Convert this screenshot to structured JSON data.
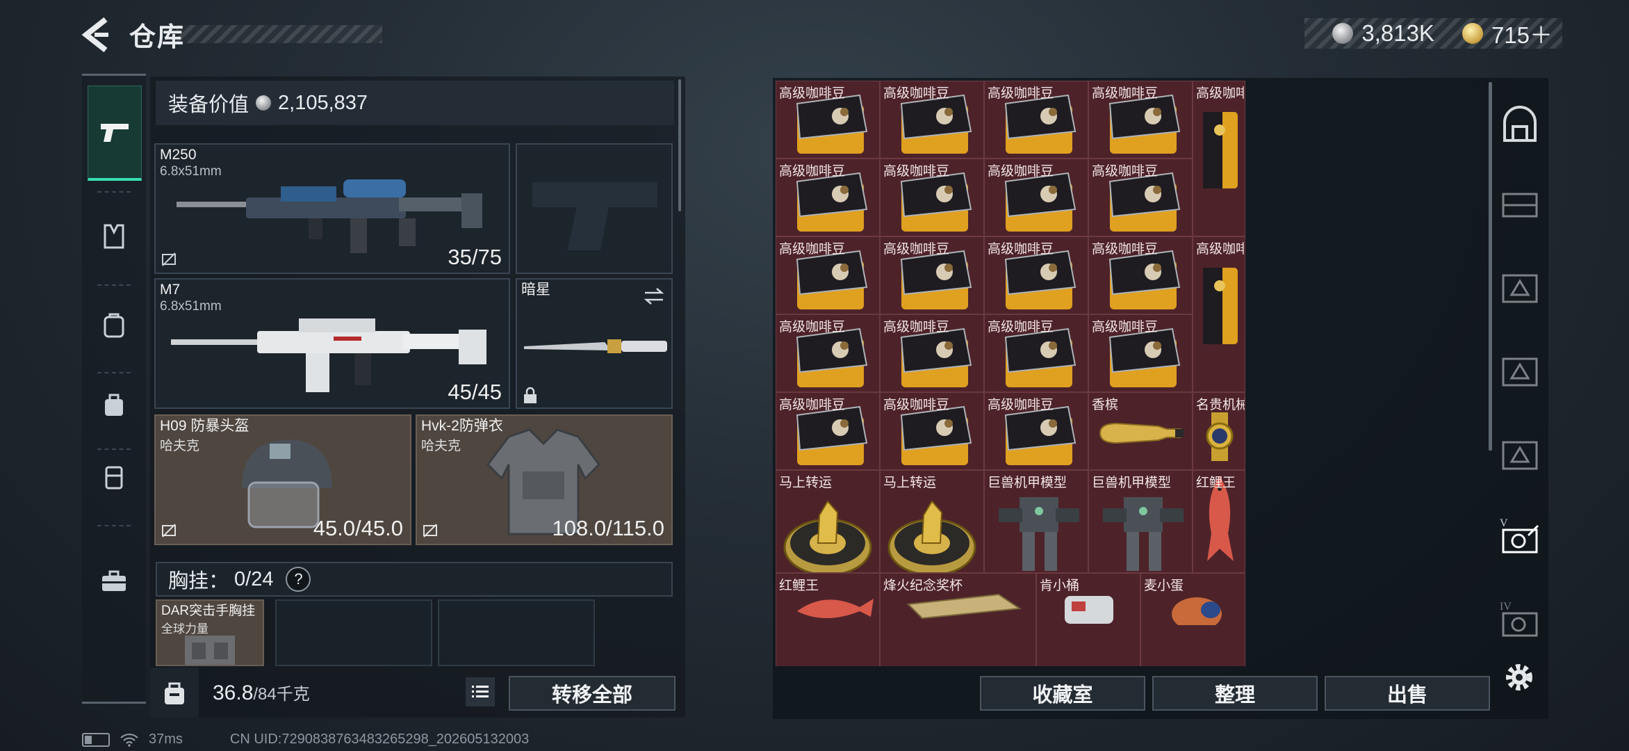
{
  "header": {
    "title": "仓库"
  },
  "currency": {
    "silver": "3,813K",
    "gold": "715＋"
  },
  "equipment": {
    "value_label": "装备价值",
    "value": "2,105,837",
    "primary": {
      "name": "M250",
      "caliber": "6.8x51mm",
      "ammo": "35/75"
    },
    "secondary": {
      "name": "M7",
      "caliber": "6.8x51mm",
      "ammo": "45/45"
    },
    "melee": {
      "name": "暗星"
    },
    "helmet": {
      "name": "H09 防暴头盔",
      "brand": "哈夫克",
      "durability": "45.0/45.0"
    },
    "armor": {
      "name": "Hvk-2防弹衣",
      "brand": "哈夫克",
      "durability": "108.0/115.0"
    },
    "chest": {
      "label": "胸挂：",
      "count": "0/24",
      "help": "?",
      "item_name": "DAR突击手胸挂",
      "item_sub": "全球力量"
    }
  },
  "bottom_left": {
    "weight": "36.8",
    "capacity": "/84千克",
    "transfer_all": "转移全部"
  },
  "bottom_right": {
    "collection": "收藏室",
    "sort": "整理",
    "sell": "出售"
  },
  "items": {
    "coffee": "高级咖啡豆",
    "champagne": "香槟",
    "watch": "名贵机械表",
    "fortune": "马上转运",
    "mech": "巨兽机甲模型",
    "koi": "红鲤王",
    "beacon_cup": "烽火纪念奖杯",
    "bucket": "肯小桶",
    "mai": "麦小蛋"
  },
  "right_sidebar": {
    "roman_4": "IV",
    "roman_5": "V"
  },
  "status_bar": {
    "ping": "37ms",
    "uid": "CN UID:7290838763483265298_202605132003"
  },
  "colors": {
    "accent": "#35e0b0",
    "cell_bg": "#4d2329",
    "armor_slot": "#4f463f"
  }
}
